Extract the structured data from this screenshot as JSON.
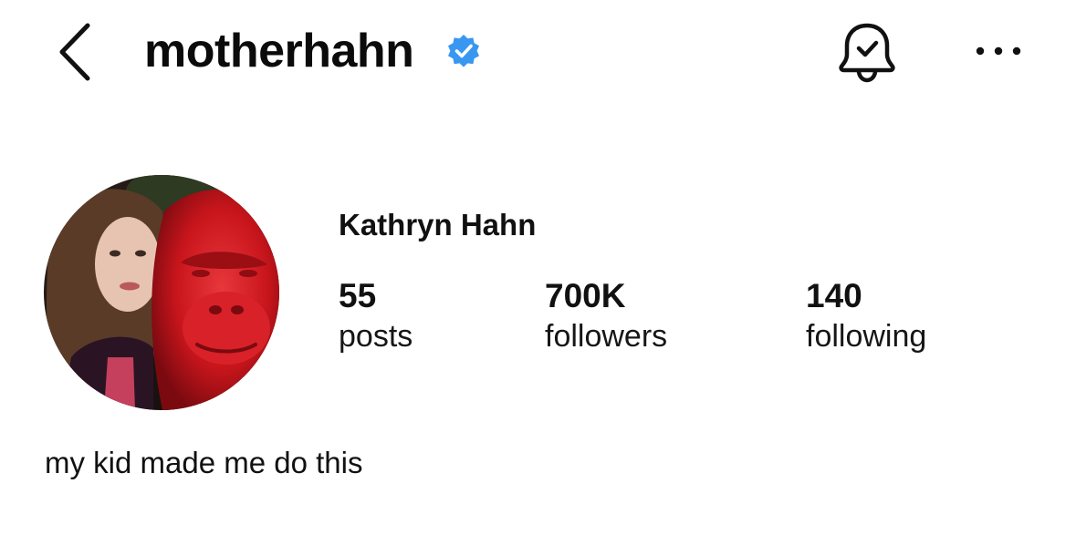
{
  "header": {
    "username": "motherhahn",
    "verified": true,
    "back_icon": "chevron-left-icon",
    "verified_icon": "verified-badge-icon",
    "notification_icon": "bell-check-icon",
    "more_icon": "more-horizontal-icon"
  },
  "profile": {
    "display_name": "Kathryn Hahn",
    "avatar_description_icon": "avatar-photo",
    "stats": [
      {
        "value": "55",
        "label": "posts"
      },
      {
        "value": "700K",
        "label": "followers"
      },
      {
        "value": "140",
        "label": "following"
      }
    ],
    "bio": "my kid made me do this"
  },
  "colors": {
    "verified_blue": "#3897f0",
    "text_primary": "#111111",
    "background": "#ffffff"
  }
}
